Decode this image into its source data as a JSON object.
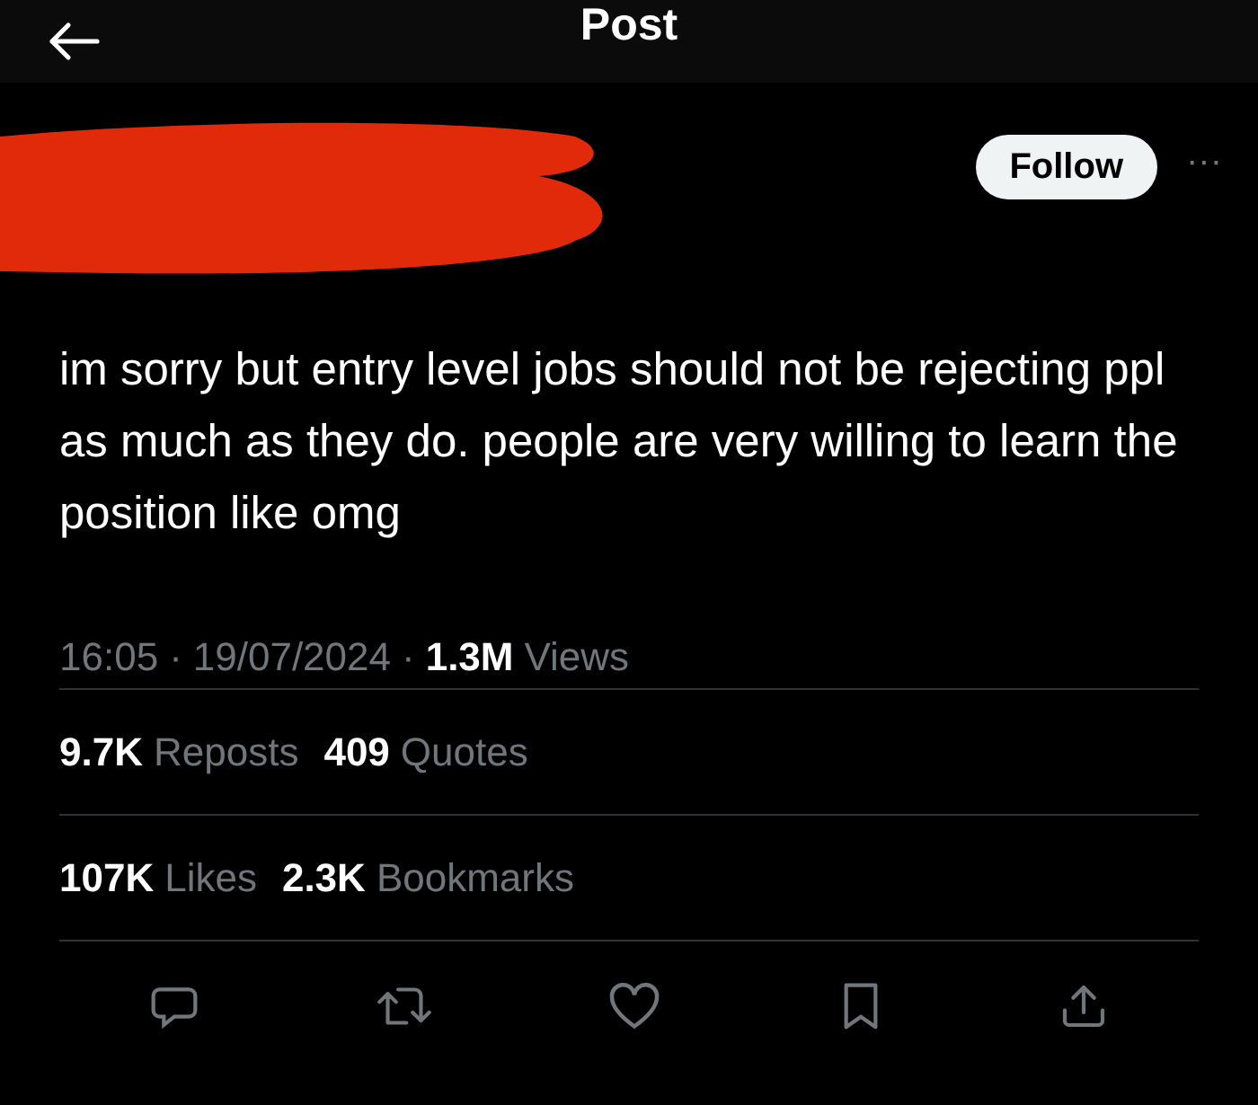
{
  "header": {
    "title": "Post"
  },
  "follow_button": {
    "label": "Follow"
  },
  "more": "···",
  "post_text": "im sorry but entry level jobs should not be rejecting ppl as much as they do. people are very willing to learn the position like omg",
  "meta": {
    "time": "16:05",
    "separator": "·",
    "date": "19/07/2024",
    "views": {
      "count": "1.3M",
      "label": "Views"
    }
  },
  "stat_rows": [
    [
      {
        "count": "9.7K",
        "label": "Reposts"
      },
      {
        "count": "409",
        "label": "Quotes"
      }
    ],
    [
      {
        "count": "107K",
        "label": "Likes"
      },
      {
        "count": "2.3K",
        "label": "Bookmarks"
      }
    ]
  ]
}
